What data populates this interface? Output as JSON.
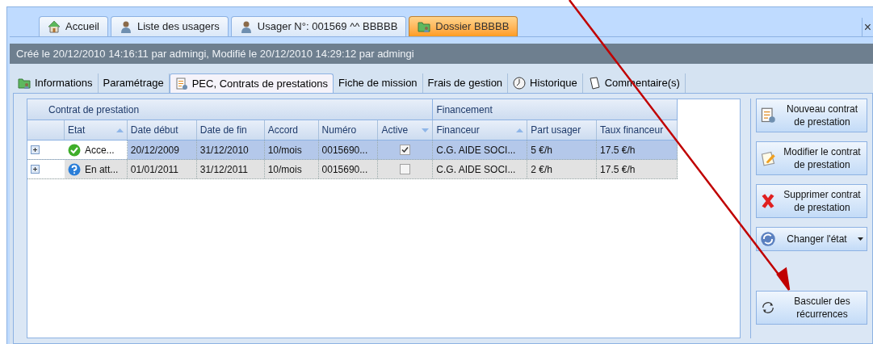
{
  "document_tabs": [
    {
      "label": "Accueil",
      "kind": "house",
      "selected": false
    },
    {
      "label": "Liste des usagers",
      "kind": "person",
      "selected": false
    },
    {
      "label": "Usager N°: 001569 ^^ BBBBB",
      "kind": "person",
      "selected": false
    },
    {
      "label": "Dossier BBBBB",
      "kind": "folder",
      "selected": true
    }
  ],
  "close_label": "×",
  "info_bar": "Créé le 20/12/2010 14:16:11 par admingi, Modifié le 20/12/2010 14:29:12 par admingi",
  "sub_tabs": [
    {
      "label": "Informations",
      "kind": "folder",
      "selected": false
    },
    {
      "label": "Paramétrage",
      "kind": "plain",
      "selected": false
    },
    {
      "label": "PEC, Contrats de prestations",
      "kind": "document",
      "selected": true
    },
    {
      "label": "Fiche de mission",
      "kind": "plain",
      "selected": false
    },
    {
      "label": "Frais de gestion",
      "kind": "plain",
      "selected": false
    },
    {
      "label": "Historique",
      "kind": "clock",
      "selected": false
    },
    {
      "label": "Commentaire(s)",
      "kind": "note",
      "selected": false
    }
  ],
  "grid": {
    "groups": [
      "Contrat de prestation",
      "Financement"
    ],
    "columns": [
      {
        "label": "Etat",
        "kind": "ascending"
      },
      {
        "label": "Date début",
        "kind": "plain"
      },
      {
        "label": "Date de fin",
        "kind": "plain"
      },
      {
        "label": "Accord",
        "kind": "plain"
      },
      {
        "label": "Numéro",
        "kind": "plain"
      },
      {
        "label": "Active",
        "kind": "descending"
      },
      {
        "label": "Financeur",
        "kind": "ascending"
      },
      {
        "label": "Part usager",
        "kind": "plain"
      },
      {
        "label": "Taux financeur",
        "kind": "plain"
      }
    ],
    "rows": [
      {
        "selected": true,
        "kind": "accepted",
        "etat": "Acce...",
        "date_debut": "20/12/2009",
        "date_de_fin": "31/12/2010",
        "accord": "10/mois",
        "numero": "0015690...",
        "active": true,
        "financeur": "C.G. AIDE SOCI...",
        "part_usager": "5 €/h",
        "taux_financeur": "17.5 €/h"
      },
      {
        "selected": false,
        "kind": "pending",
        "etat": "En att...",
        "date_debut": "01/01/2011",
        "date_de_fin": "31/12/2011",
        "accord": "10/mois",
        "numero": "0015690...",
        "active": false,
        "financeur": "C.G. AIDE SOCI...",
        "part_usager": "2 €/h",
        "taux_financeur": "17.5 €/h"
      }
    ]
  },
  "buttons": [
    {
      "label": "Nouveau contrat de prestation",
      "kind": "document",
      "dropdown": false
    },
    {
      "label": "Modifier le contrat de prestation",
      "kind": "pencil",
      "dropdown": false
    },
    {
      "label": "Supprimer contrat de prestation",
      "kind": "cross",
      "dropdown": false
    },
    {
      "label": "Changer l'état",
      "kind": "cycle",
      "dropdown": true
    },
    {
      "label": "Basculer des récurrences",
      "kind": "arrows",
      "dropdown": false
    }
  ]
}
